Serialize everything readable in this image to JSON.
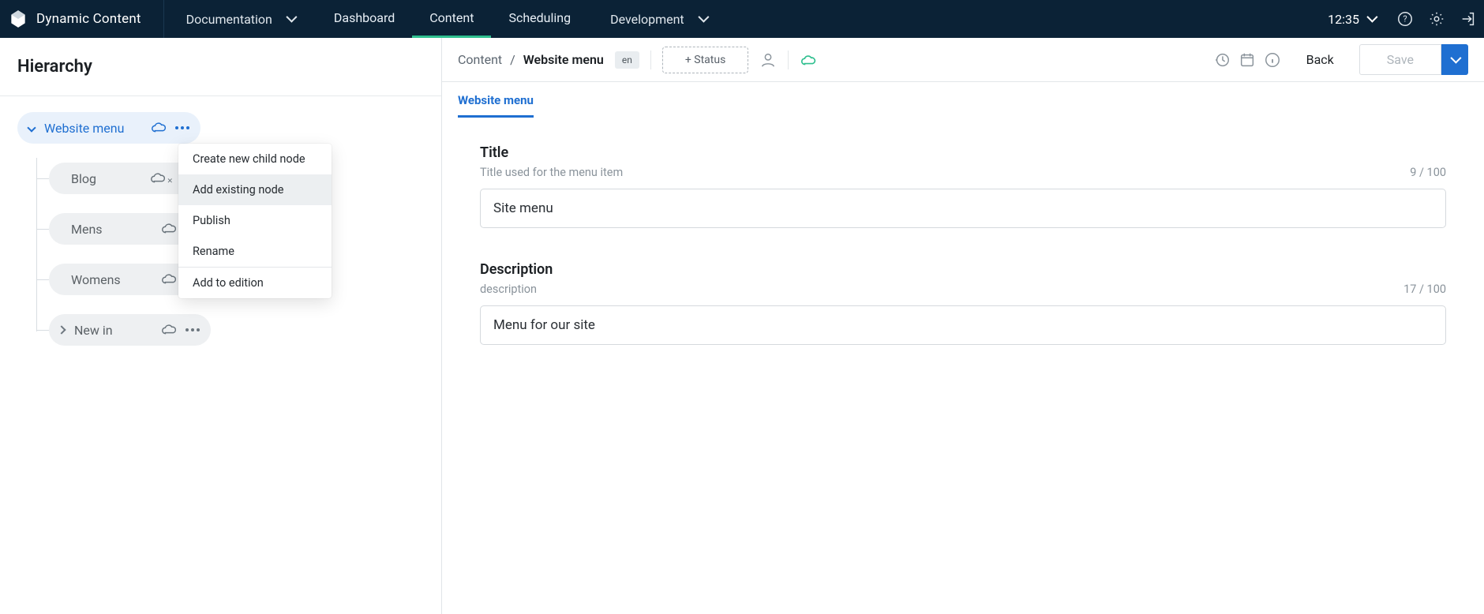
{
  "header": {
    "app_name": "Dynamic Content",
    "section_dropdown": "Documentation",
    "nav": [
      "Dashboard",
      "Content",
      "Scheduling"
    ],
    "active_nav_index": 1,
    "env_dropdown": "Development",
    "time": "12:35"
  },
  "sidebar": {
    "title": "Hierarchy",
    "root": {
      "label": "Website menu"
    },
    "children": [
      {
        "label": "Blog",
        "expandable": false,
        "cloud_variant": "x"
      },
      {
        "label": "Mens",
        "expandable": false,
        "cloud_variant": "plain"
      },
      {
        "label": "Womens",
        "expandable": false,
        "cloud_variant": "plain"
      },
      {
        "label": "New in",
        "expandable": true,
        "cloud_variant": "plain"
      }
    ],
    "context_menu": {
      "items_top": [
        "Create new child node",
        "Add existing node",
        "Publish",
        "Rename"
      ],
      "hover_index": 1,
      "items_bottom": [
        "Add to edition"
      ]
    }
  },
  "toolbar": {
    "crumb_root": "Content",
    "crumb_sep": "/",
    "crumb_current": "Website menu",
    "lang": "en",
    "status_button": "+ Status",
    "back": "Back",
    "save": "Save"
  },
  "doc_tabs": [
    "Website menu"
  ],
  "form": {
    "title": {
      "label": "Title",
      "hint": "Title used for the menu item",
      "counter": "9 / 100",
      "value": "Site menu"
    },
    "description": {
      "label": "Description",
      "hint": "description",
      "counter": "17 / 100",
      "value": "Menu for our site"
    }
  }
}
